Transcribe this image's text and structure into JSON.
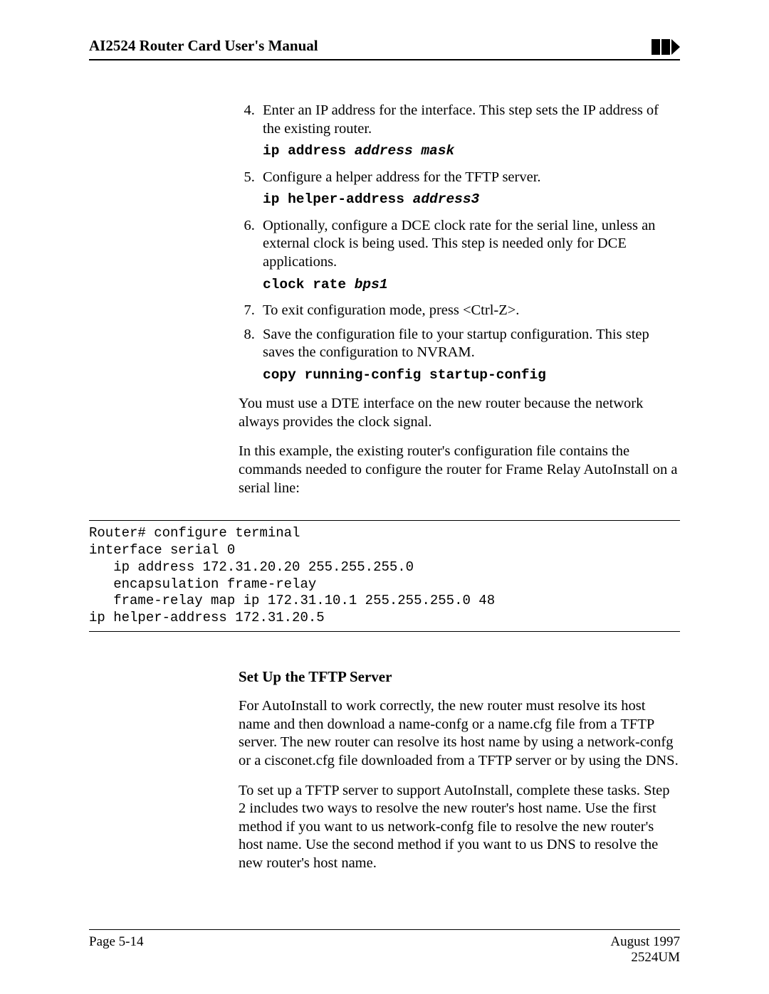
{
  "header": {
    "title": "AI2524 Router Card User's Manual"
  },
  "steps": {
    "s4_text": "Enter an IP address for the interface. This step sets the IP address of the existing router.",
    "s4_cmd_a": "ip address",
    "s4_cmd_b": "address mask",
    "s5_text": "Configure a helper address for the TFTP server.",
    "s5_cmd_a": "ip helper-address",
    "s5_cmd_b": "address3",
    "s6_text": "Optionally, configure a DCE clock rate for the serial line, unless an external clock is being used. This step is needed only for DCE applications.",
    "s6_cmd_a": "clock rate",
    "s6_cmd_b": "bps1",
    "s7_text": "To exit configuration mode, press <Ctrl-Z>.",
    "s8_text": "Save the configuration file to your startup configuration. This step saves the configuration to NVRAM.",
    "s8_cmd_a": "copy running-config startup-config"
  },
  "body": {
    "p1": "You must use a DTE interface on the new router because the network always provides the clock signal.",
    "p2": "In this example, the existing router's configuration file contains the commands needed to configure the router for Frame Relay AutoInstall on a serial line:"
  },
  "code_block": "Router# configure terminal\ninterface serial 0\n   ip address 172.31.20.20 255.255.255.0\n   encapsulation frame-relay\n   frame-relay map ip 172.31.10.1 255.255.255.0 48\nip helper-address 172.31.20.5",
  "section": {
    "title": "Set Up the TFTP Server",
    "p1": "For AutoInstall to work correctly, the new router must resolve its host name and then download a name-confg or a name.cfg file from a TFTP server. The new router can resolve its host name by using a network-confg or a cisconet.cfg file downloaded from a TFTP server or by using the DNS.",
    "p2": "To set up a TFTP server to support AutoInstall, complete these tasks. Step 2 includes two ways to resolve the new router's host name. Use the first method if you want to us     network-confg file to resolve the new router's host name. Use the second method if you want to us DNS to resolve the new router's host name."
  },
  "footer": {
    "page": "Page 5-14",
    "date": "August 1997",
    "docnum": "2524UM"
  }
}
